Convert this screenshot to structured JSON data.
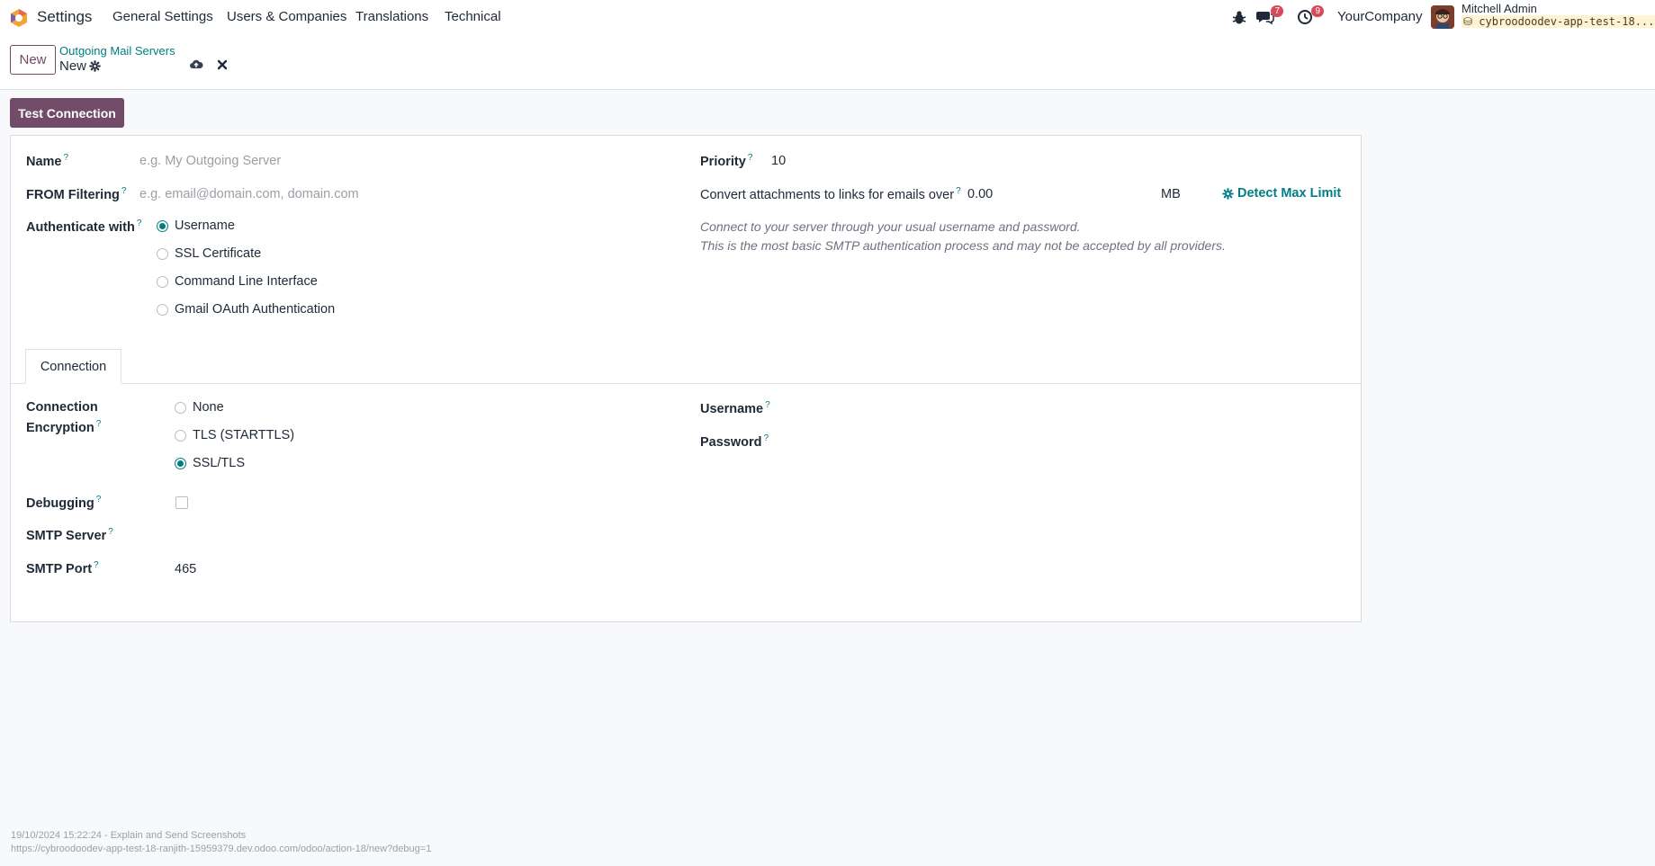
{
  "navbar": {
    "app_name": "Settings",
    "menus": [
      "General Settings",
      "Users & Companies",
      "Translations",
      "Technical"
    ],
    "messages_count": "7",
    "activities_count": "9",
    "company": "YourCompany",
    "user_name": "Mitchell Admin",
    "db_name": "cybroodoodev-app-test-18..."
  },
  "control_panel": {
    "new_label": "New",
    "breadcrumb": "Outgoing Mail Servers",
    "record_title": "New"
  },
  "actions": {
    "test_connection": "Test Connection"
  },
  "form": {
    "name_label": "Name",
    "name_placeholder": "e.g. My Outgoing Server",
    "from_filter_label": "FROM Filtering",
    "from_filter_placeholder": "e.g. email@domain.com, domain.com",
    "auth_label": "Authenticate with",
    "auth_options": [
      "Username",
      "SSL Certificate",
      "Command Line Interface",
      "Gmail OAuth Authentication"
    ],
    "auth_selected": "Username",
    "priority_label": "Priority",
    "priority_value": "10",
    "attach_label": "Convert attachments to links for emails over",
    "attach_value": "0.00",
    "attach_unit": "MB",
    "detect_label": "Detect Max Limit",
    "hint_line1": "Connect to your server through your usual username and password.",
    "hint_line2": "This is the most basic SMTP authentication process and may not be accepted by all providers."
  },
  "tabs": {
    "connection": "Connection"
  },
  "connection": {
    "encryption_label_1": "Connection",
    "encryption_label_2": "Encryption",
    "encryption_options": [
      "None",
      "TLS (STARTTLS)",
      "SSL/TLS"
    ],
    "encryption_selected": "SSL/TLS",
    "debugging_label": "Debugging",
    "smtp_server_label": "SMTP Server",
    "smtp_port_label": "SMTP Port",
    "smtp_port_value": "465",
    "username_label": "Username",
    "password_label": "Password"
  },
  "footer": {
    "line1": "19/10/2024 15:22:24 - Explain and Send Screenshots",
    "line2": "https://cybroodoodev-app-test-18-ranjith-15959379.dev.odoo.com/odoo/action-18/new?debug=1"
  },
  "colors": {
    "brand": "#714b67",
    "accent": "#017e84",
    "badge": "#d44c59"
  }
}
